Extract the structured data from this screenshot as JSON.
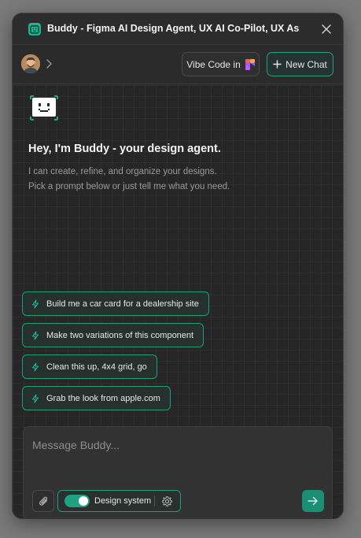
{
  "window": {
    "title": "Buddy - Figma AI Design Agent, UX AI Co-Pilot, UX As..."
  },
  "toolbar": {
    "vibe_label": "Vibe Code in",
    "new_chat_label": "New Chat"
  },
  "intro": {
    "greeting": "Hey, I'm Buddy - your design agent.",
    "line1": "I can create, refine, and organize your designs.",
    "line2": "Pick a prompt below or just tell me what you need."
  },
  "prompts": [
    {
      "label": "Build me a car card for a dealership site"
    },
    {
      "label": "Make two variations of this component"
    },
    {
      "label": "Clean this up, 4x4 grid, go"
    },
    {
      "label": "Grab the look from apple.com"
    }
  ],
  "composer": {
    "placeholder": "Message Buddy...",
    "design_system_label": "Design system",
    "design_system_enabled": true
  },
  "icons": {
    "app": "buddy-app-icon",
    "close": "close-icon",
    "chevron": "chevron-right-icon",
    "vibe": "figma-make-icon",
    "new_chat": "plus-icon",
    "prompt": "bolt-icon",
    "attach": "paperclip-icon",
    "settings": "gear-icon",
    "send": "arrow-right-icon"
  },
  "colors": {
    "accent": "#1fa184",
    "window_bg": "#2b2b2b",
    "content_bg": "#262626"
  }
}
